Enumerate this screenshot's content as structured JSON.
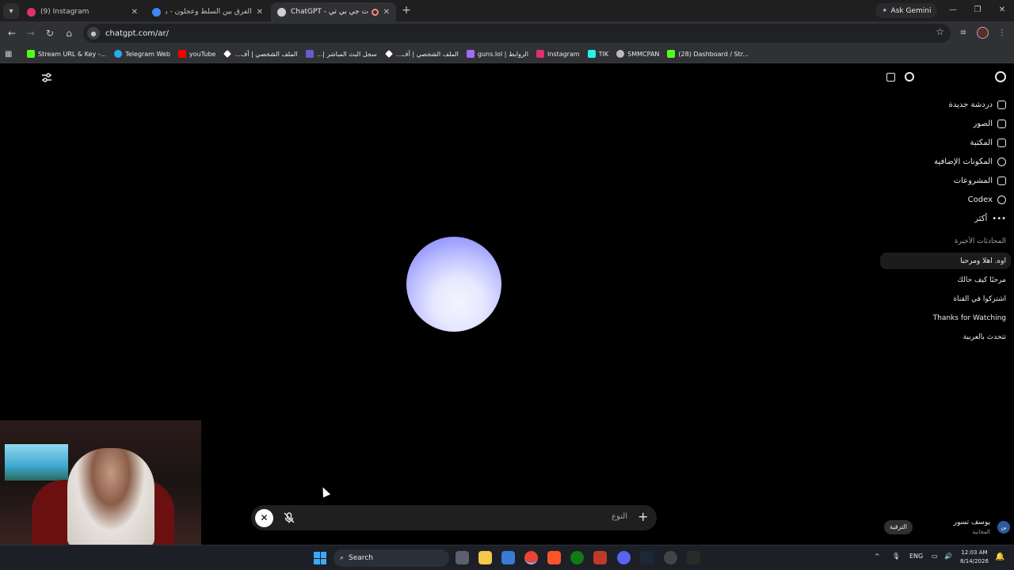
{
  "browser": {
    "tabs": [
      {
        "title": "(9) Instagram",
        "active": false,
        "color": "#e1306c"
      },
      {
        "title": "الفرق بين السلط وعجلون - بحث",
        "active": false,
        "color": "#4285f4"
      },
      {
        "title": "ChatGPT - شات جي بي تي",
        "active": true,
        "color": "#cfcfcf"
      }
    ],
    "ask_gemini": "Ask Gemini",
    "url": "chatgpt.com/ar/",
    "bookmarks": [
      {
        "label": "Stream URL & Key -...",
        "color": "#53fc18"
      },
      {
        "label": "Telegram Web",
        "color": "#2aabee"
      },
      {
        "label": "youTube",
        "color": "#ff0000"
      },
      {
        "label": "الملف الشخصي | أف...",
        "color": "#ffffff"
      },
      {
        "label": "سجل البث المباشر |...",
        "color": "#6a5acd"
      },
      {
        "label": "الملف الشخصي | أف...",
        "color": "#ffffff"
      },
      {
        "label": "guns.lol | الروابط",
        "color": "#a06cff"
      },
      {
        "label": "Instagram",
        "color": "#e1306c"
      },
      {
        "label": "TIK",
        "color": "#25f4ee"
      },
      {
        "label": "SMMCPAN",
        "color": "#bbbbbb"
      },
      {
        "label": "(28) Dashboard / Str...",
        "color": "#53fc18"
      }
    ]
  },
  "sidebar": {
    "nav": [
      {
        "label": "دردشة جديدة",
        "icon": "new-chat-icon"
      },
      {
        "label": "الصور",
        "icon": "images-icon"
      },
      {
        "label": "المكتبة",
        "icon": "library-icon"
      },
      {
        "label": "المكونات الإضافية",
        "icon": "plugins-icon"
      },
      {
        "label": "المشروعات",
        "icon": "folder-icon"
      },
      {
        "label": "Codex",
        "icon": "codex-icon"
      },
      {
        "label": "أكثر",
        "icon": "more-icon"
      }
    ],
    "recent_header": "المحادثات الأخيرة",
    "chats": [
      "اوه. اهلا ومرحبا",
      "مرحبًا كيف حالك",
      "اشتركوا في القناة",
      "Thanks for Watching",
      "تتحدث بالعربية"
    ],
    "upgrade_label": "الترقية",
    "user_name": "يوسف تسور",
    "user_plan": "المجانية",
    "avatar_initials": "ين"
  },
  "voice": {
    "type_label": "النوع"
  },
  "taskbar": {
    "search_label": "Search",
    "language": "ENG",
    "time": "12:03 AM",
    "date": "8/14/2026"
  }
}
